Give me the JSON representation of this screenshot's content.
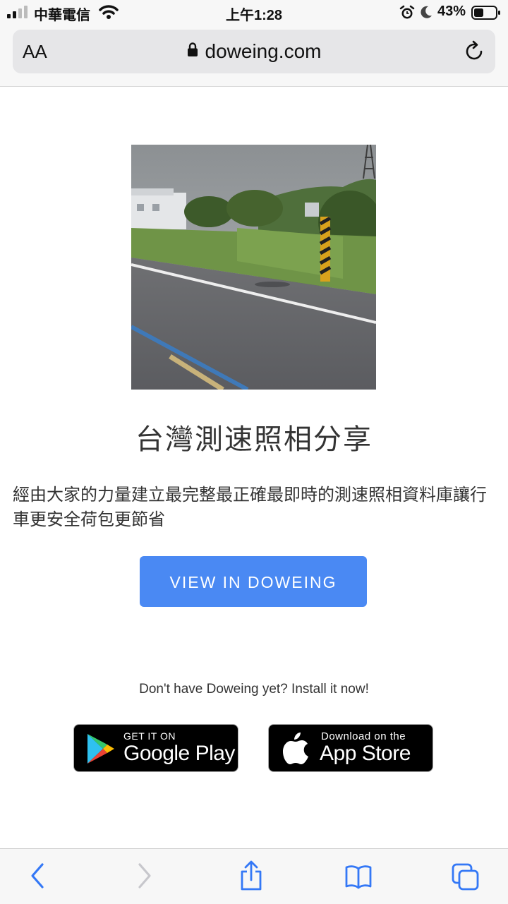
{
  "status_bar": {
    "carrier": "中華電信",
    "time": "上午1:28",
    "battery_percent": "43%",
    "icons": [
      "signal-icon",
      "wifi-icon",
      "alarm-icon",
      "moon-icon",
      "battery-icon"
    ]
  },
  "address_bar": {
    "aa_label": "AA",
    "url": "doweing.com",
    "icons": [
      "lock-icon",
      "reload-icon"
    ]
  },
  "content": {
    "title": "台灣測速照相分享",
    "description": "經由大家的力量建立最完整最正確最即時的測速照相資料庫讓行車更安全荷包更節省",
    "view_button_label": "VIEW IN DOWEING",
    "install_prompt": "Don't have Doweing yet? Install it now!"
  },
  "badges": {
    "google": {
      "small": "GET IT ON",
      "big": "Google Play"
    },
    "apple": {
      "small": "Download on the",
      "big": "App Store"
    }
  },
  "toolbar": {
    "icons": [
      "back-icon",
      "forward-icon",
      "share-icon",
      "bookmarks-icon",
      "tabs-icon"
    ]
  },
  "colors": {
    "button_blue": "#4a89f3",
    "chrome_bg": "#f7f7f7",
    "address_bg": "#e6e6e8",
    "toolbar_icon": "#3478f6",
    "toolbar_disabled": "#c7c7cc"
  }
}
